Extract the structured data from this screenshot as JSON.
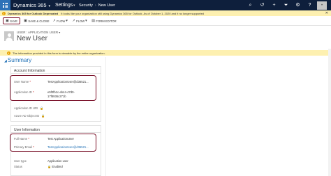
{
  "topbar": {
    "brand": "Dynamics 365",
    "area": "Settings",
    "breadcrumb": [
      "Security",
      "New User"
    ],
    "icons": [
      "search-icon",
      "history-icon",
      "add-icon",
      "filter-icon",
      "gear-icon",
      "help-icon"
    ],
    "avatar_initial": "•"
  },
  "notification": {
    "title": "Dynamics 365 for Outlook Deprecated",
    "message": "It looks like your organization still using Dynamics 365 for Outlook. As of October 1, 2020 and it no longer supported"
  },
  "commands": {
    "save": "SAVE",
    "save_close": "SAVE & CLOSE",
    "flow1": "FLOW",
    "flow2": "FLOW",
    "form_editor": "FORM EDITOR"
  },
  "header": {
    "entity": "USER : APPLICATION USER",
    "title": "New User"
  },
  "info": {
    "message": "The information provided in this form is viewable by the entire organization."
  },
  "summary": {
    "title": "Summary",
    "account": {
      "heading": "Account Information",
      "user_name_label": "User Name",
      "user_name_value": "TestApplicationUser@d36521...",
      "app_id_label": "Application ID",
      "app_id_value_1": "e5f0fb1c-eb44-47d0-",
      "app_id_value_2": "17f8936c271b",
      "app_id_uri_label": "Application ID URI",
      "azure_id_label": "Azure AD Object ID"
    },
    "user": {
      "heading": "User Information",
      "full_name_label": "Full Name",
      "full_name_value": "Test ApplicationUser",
      "email_label": "Primary Email",
      "email_value": "TestApplicationUser@d36521...",
      "user_type_label": "User type",
      "user_type_value": "Application user",
      "status_label": "Status",
      "status_value": "Enabled"
    }
  },
  "colors": {
    "nav": "#0e1f3c",
    "accent": "#1e6fb5",
    "highlight": "#7a1028",
    "warning_bg": "#fdf0b0"
  }
}
